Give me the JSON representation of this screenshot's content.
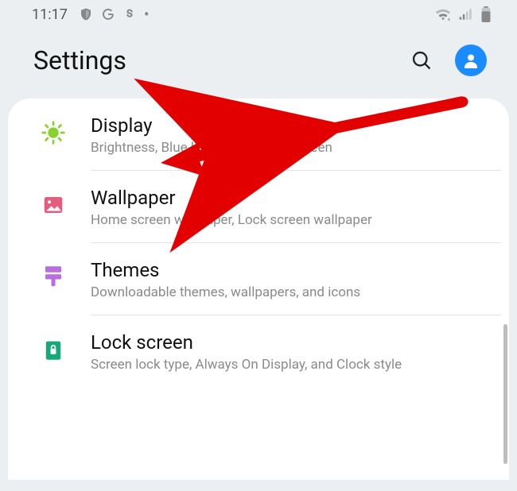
{
  "status": {
    "time": "11:17",
    "left_icons": [
      "shield-icon",
      "g-icon",
      "s-icon",
      "dot-icon"
    ],
    "right_icons": [
      "wifi-icon",
      "signal-icon",
      "battery-icon"
    ]
  },
  "header": {
    "title": "Settings"
  },
  "items": [
    {
      "icon": "brightness-icon",
      "icon_color": "#86d12a",
      "title": "Display",
      "desc": "Brightness, Blue light filter, Home screen"
    },
    {
      "icon": "photo-icon",
      "icon_color": "#e65c7e",
      "title": "Wallpaper",
      "desc": "Home screen wallpaper, Lock screen wallpaper"
    },
    {
      "icon": "brush-icon",
      "icon_color": "#b96de0",
      "title": "Themes",
      "desc": "Downloadable themes, wallpapers, and icons"
    },
    {
      "icon": "lock-icon",
      "icon_color": "#17a877",
      "title": "Lock screen",
      "desc": "Screen lock type, Always On Display, and Clock style"
    }
  ]
}
